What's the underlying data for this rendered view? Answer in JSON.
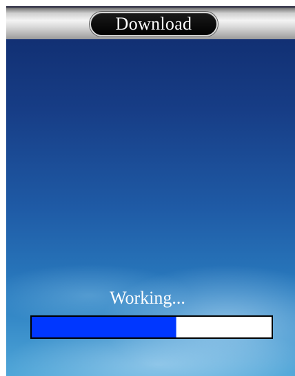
{
  "window": {
    "title": "Download"
  },
  "status": {
    "text": "Working...",
    "progress_fraction": 0.6
  },
  "colors": {
    "progress_fill": "#0037ff",
    "progress_track": "#ffffff",
    "title_pill": "#000000",
    "text": "#ffffff"
  }
}
